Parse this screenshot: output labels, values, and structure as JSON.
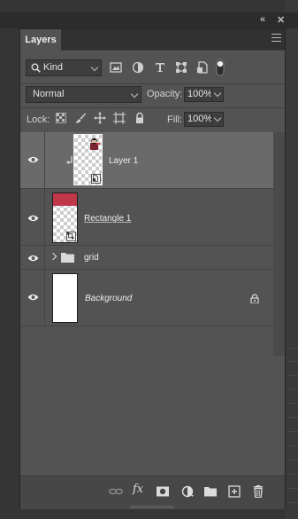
{
  "window": {
    "collapse_icon": "double-chevron-icon",
    "close_icon": "close-icon",
    "collapse_glyph": "«",
    "close_glyph": "✕"
  },
  "panel": {
    "tab_label": "Layers",
    "menu_icon": "hamburger-menu-icon"
  },
  "filter": {
    "kind_label": "Kind",
    "filter_icons": [
      "image-filter-icon",
      "adjustment-filter-icon",
      "type-filter-icon",
      "shape-filter-icon",
      "smart-object-filter-icon",
      "filter-toggle-icon"
    ]
  },
  "blend": {
    "mode": "Normal",
    "opacity_label": "Opacity:",
    "opacity_value": "100%"
  },
  "lock": {
    "label": "Lock:",
    "icons": [
      "lock-transparent-pixels-icon",
      "lock-image-pixels-icon",
      "lock-position-icon",
      "lock-artboard-icon",
      "lock-all-icon"
    ],
    "fill_label": "Fill:",
    "fill_value": "100%"
  },
  "layers": [
    {
      "name": "Layer 1",
      "type": "smart-object",
      "selected": true,
      "clipped": true
    },
    {
      "name": "Rectangle 1",
      "type": "shape",
      "selected": false,
      "color": "#c0374a"
    },
    {
      "name": "grid",
      "type": "group",
      "selected": false
    },
    {
      "name": "Background",
      "type": "background",
      "selected": false,
      "locked": true
    }
  ],
  "bottom_bar": {
    "icons": [
      "link-layers-icon",
      "fx-icon",
      "add-mask-icon",
      "adjustment-layer-icon",
      "new-group-icon",
      "new-layer-icon",
      "delete-layer-icon"
    ],
    "fx_text": "fx"
  },
  "colors": {
    "panel_bg": "#535353",
    "selected_row": "#6a6a6a",
    "shape_fill": "#c0374a"
  }
}
